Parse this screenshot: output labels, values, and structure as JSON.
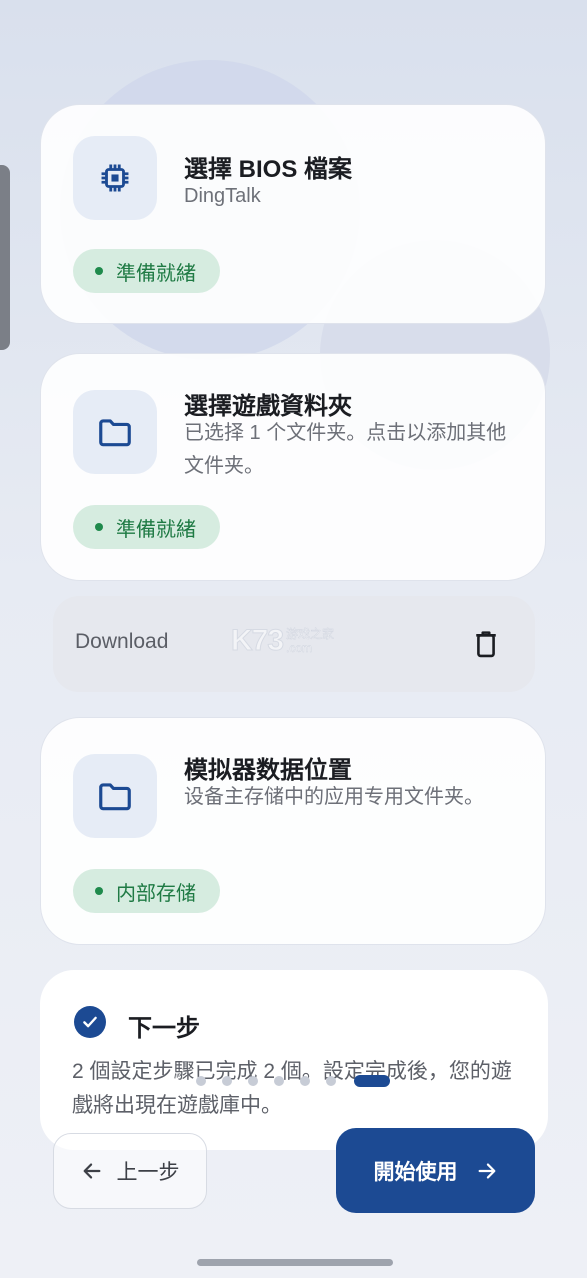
{
  "cards": [
    {
      "title": "選擇 BIOS 檔案",
      "subtitle": "DingTalk",
      "icon": "chip-icon",
      "status": "準備就緒"
    },
    {
      "title": "選擇遊戲資料夾",
      "subtitle": "已选择 1 个文件夹。点击以添加其他文件夹。",
      "icon": "folder-icon",
      "status": "準備就緒"
    },
    {
      "title": "模拟器数据位置",
      "subtitle": "设备主存储中的应用专用文件夹。",
      "icon": "folder-icon",
      "status": "内部存储"
    }
  ],
  "folder_entry": {
    "name": "Download",
    "action_icon": "trash-icon"
  },
  "watermark": {
    "logo": "K73",
    "side_top": "游戏之家",
    "side_bottom": ".com"
  },
  "next_step": {
    "title": "下一步",
    "body": "2 個設定步驟已完成 2 個。設定完成後，您的遊戲將出現在遊戲庫中。"
  },
  "pager": {
    "total": 7,
    "current": 7
  },
  "buttons": {
    "previous": "上一步",
    "start": "開始使用"
  },
  "colors": {
    "accent": "#1c4a93",
    "status_bg": "#d6ece0",
    "status_text": "#1f7a44"
  }
}
